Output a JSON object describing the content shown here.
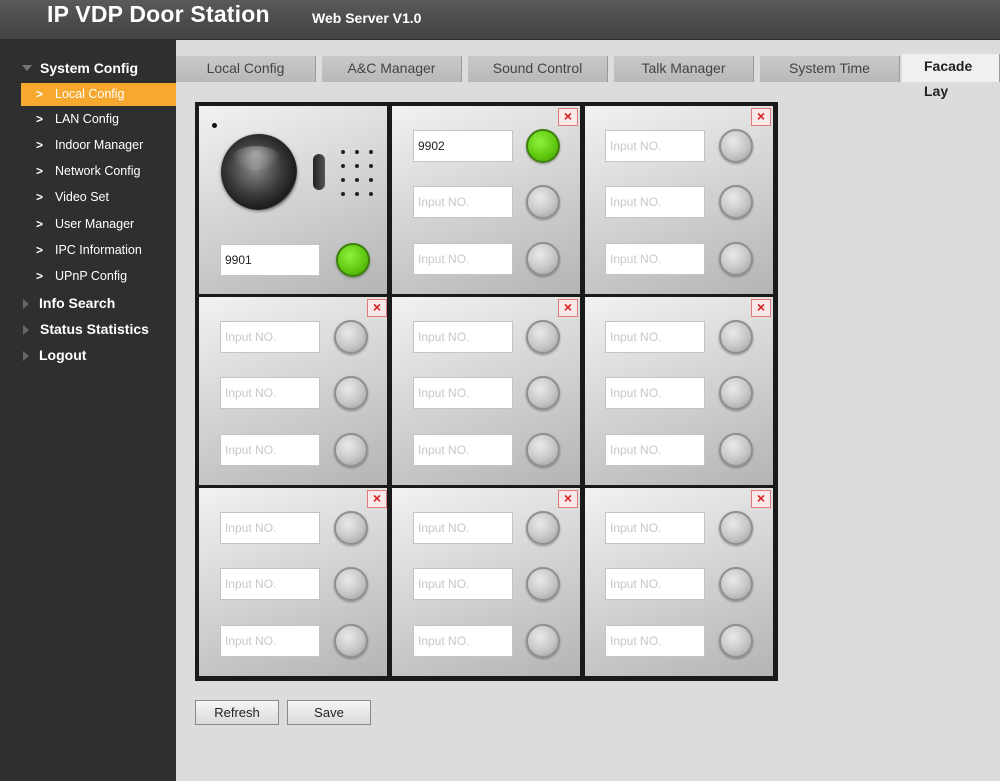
{
  "header": {
    "title": "IP VDP Door Station",
    "version": "Web Server V1.0"
  },
  "sidebar": {
    "system_config": {
      "label": "System Config",
      "items": [
        {
          "label": "Local Config"
        },
        {
          "label": "LAN Config"
        },
        {
          "label": "Indoor Manager"
        },
        {
          "label": "Network Config"
        },
        {
          "label": "Video Set"
        },
        {
          "label": "User Manager"
        },
        {
          "label": "IPC Information"
        },
        {
          "label": "UPnP Config"
        }
      ]
    },
    "info_search": "Info Search",
    "status_statistics": "Status Statistics",
    "logout": "Logout"
  },
  "tabs": [
    "Local Config",
    "A&C Manager",
    "Sound Control",
    "Talk Manager",
    "System Time",
    "Facade Lay"
  ],
  "facade": {
    "placeholder": "Input NO.",
    "delete_glyph": "×",
    "camera_number": "9901",
    "panel2_first_number": "9902"
  },
  "buttons": {
    "refresh": "Refresh",
    "save": "Save"
  },
  "colors": {
    "accent": "#f6a82f",
    "active_button": "#5ec60f",
    "delete": "#d42020"
  }
}
